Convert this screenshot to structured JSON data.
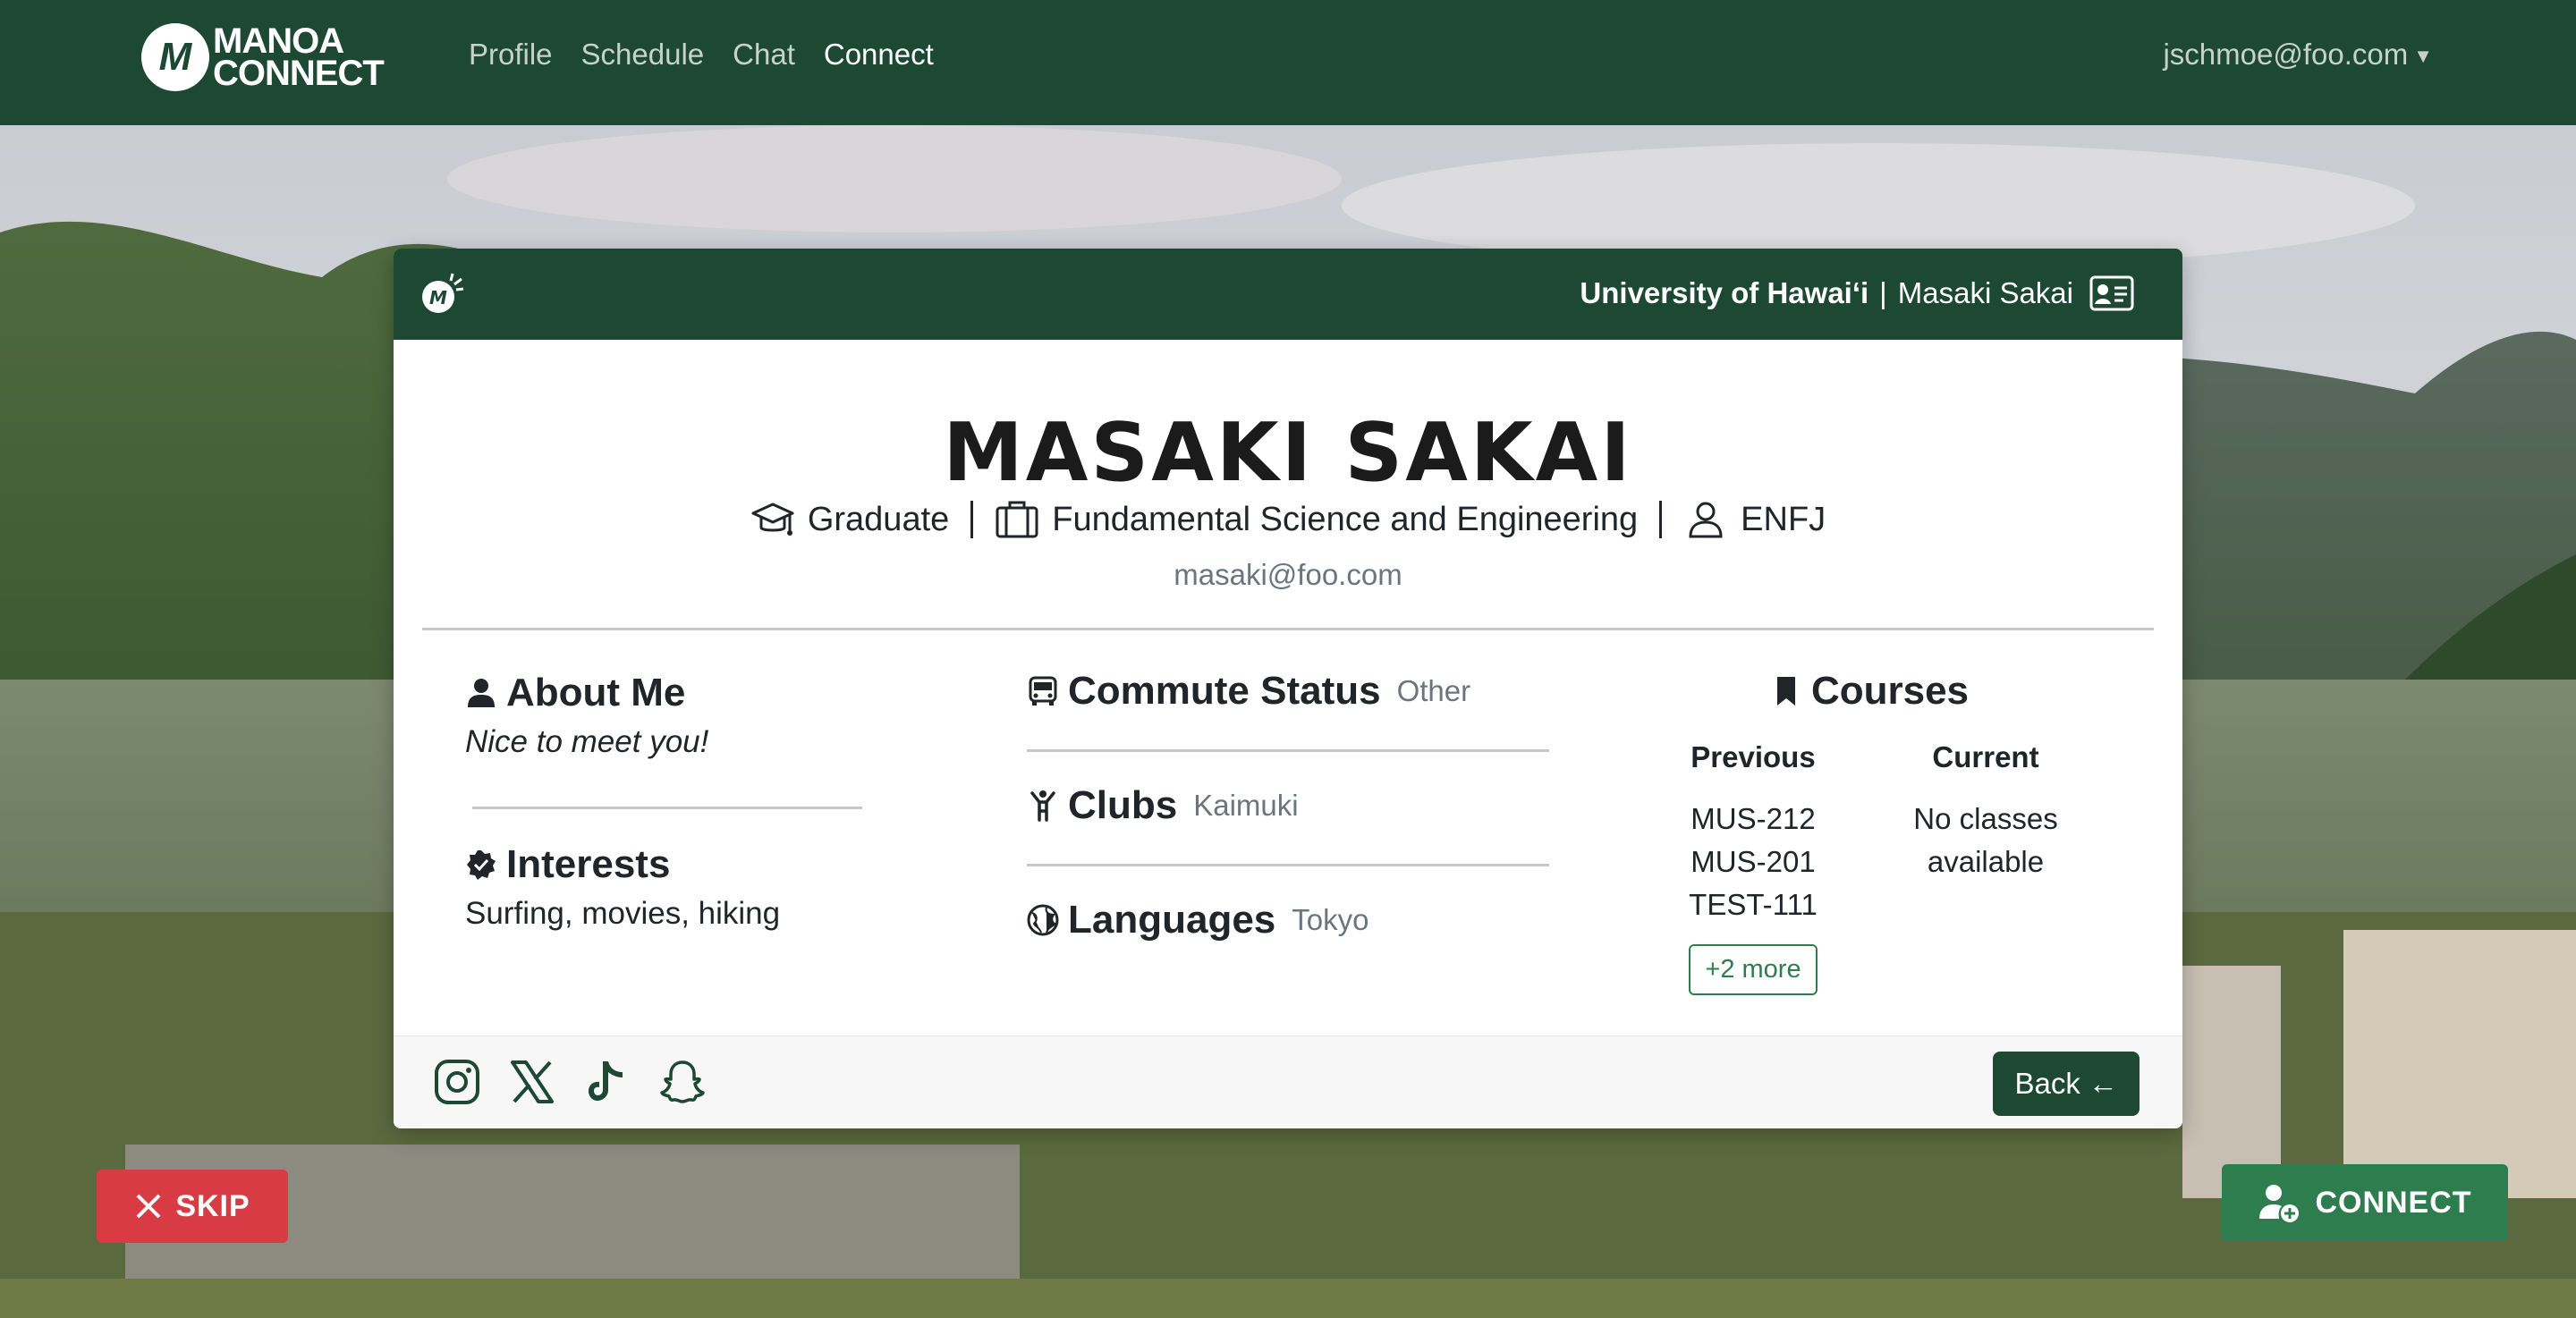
{
  "navbar": {
    "brand_line1": "MANOA",
    "brand_line2": "CONNECT",
    "links": [
      "Profile",
      "Schedule",
      "Chat",
      "Connect"
    ],
    "active_link": "Connect",
    "user_email": "jschmoe@foo.com"
  },
  "card": {
    "header": {
      "university": "University of Hawai‘i",
      "separator": "|",
      "name": "Masaki Sakai"
    },
    "name": "MASAKI SAKAI",
    "level": "Graduate",
    "department": "Fundamental Science and Engineering",
    "personality": "ENFJ",
    "email": "masaki@foo.com",
    "about": {
      "title": "About Me",
      "text": "Nice to meet you!"
    },
    "interests": {
      "title": "Interests",
      "text": "Surfing, movies, hiking"
    },
    "commute": {
      "title": "Commute Status",
      "value": "Other"
    },
    "clubs": {
      "title": "Clubs",
      "value": "Kaimuki"
    },
    "languages": {
      "title": "Languages",
      "value": "Tokyo"
    },
    "courses": {
      "title": "Courses",
      "previous_label": "Previous",
      "current_label": "Current",
      "previous": [
        "MUS-212",
        "MUS-201",
        "TEST-111"
      ],
      "current_text": "No classes available",
      "more_label": "+2 more"
    },
    "footer": {
      "socials": [
        "instagram-icon",
        "x-icon",
        "tiktok-icon",
        "snapchat-icon"
      ],
      "back_label": "Back ←"
    }
  },
  "actions": {
    "skip_label": "SKIP",
    "connect_label": "CONNECT"
  },
  "colors": {
    "primary": "#1c4834",
    "accent_green": "#2e7d4f",
    "skip_red": "#d83b44"
  }
}
